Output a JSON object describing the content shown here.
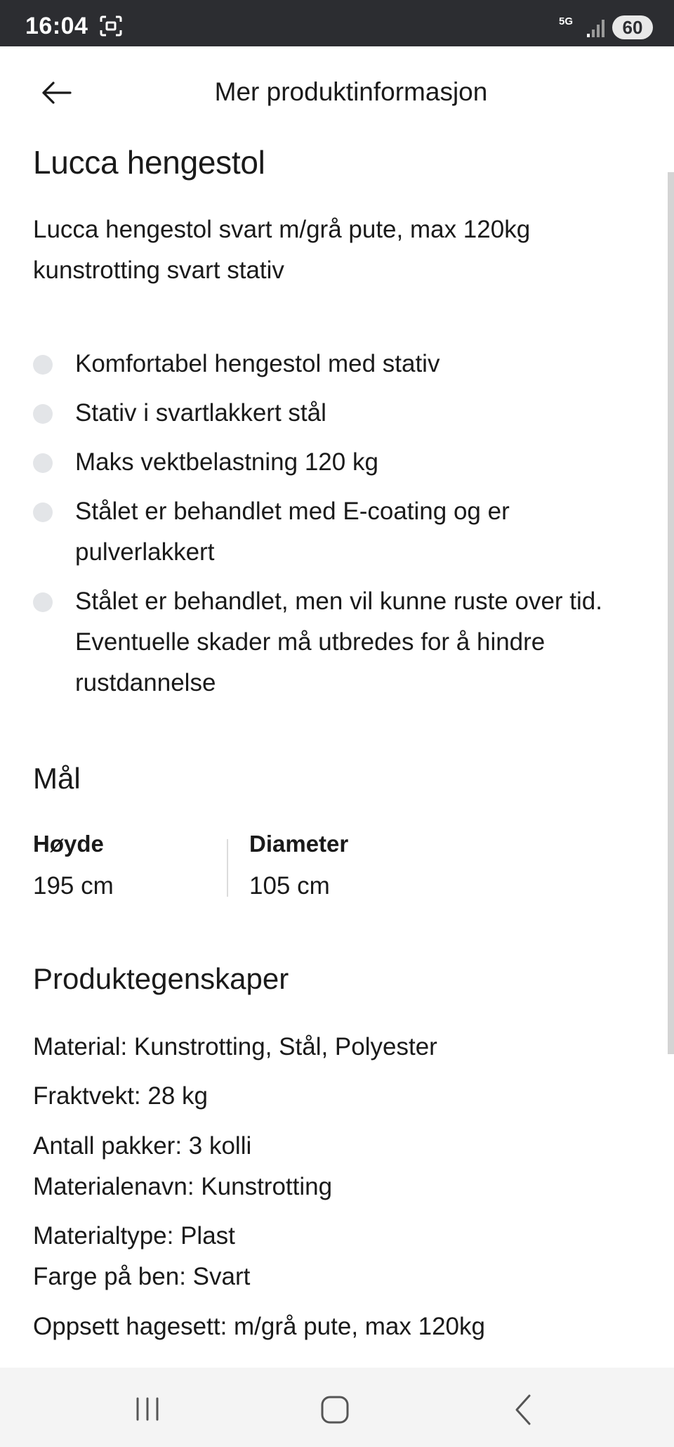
{
  "status_bar": {
    "time": "16:04",
    "network": "5G",
    "battery": "60"
  },
  "app_bar": {
    "title": "Mer produktinformasjon"
  },
  "product": {
    "name": "Lucca hengestol",
    "description": "Lucca hengestol svart m/grå pute, max 120kg kunstrotting svart stativ",
    "features": [
      "Komfortabel hengestol med stativ",
      "Stativ i svartlakkert stål",
      "Maks vektbelastning 120 kg",
      "Stålet er behandlet med E-coating og er pulverlakkert",
      "Stålet er behandlet, men vil kunne ruste over tid. Eventuelle skader må utbredes for å hindre rustdannelse"
    ]
  },
  "dimensions": {
    "heading": "Mål",
    "height_label": "Høyde",
    "height_value": "195 cm",
    "diameter_label": "Diameter",
    "diameter_value": "105 cm"
  },
  "properties": {
    "heading": "Produktegenskaper",
    "items": [
      "Material: Kunstrotting, Stål, Polyester",
      "Fraktvekt: 28 kg",
      "Antall pakker: 3 kolli",
      "Materialenavn: Kunstrotting",
      "Materialtype: Plast",
      "Farge på ben: Svart",
      "Oppsett hagesett: m/grå pute, max 120kg"
    ]
  },
  "nav": {
    "recent_icon": "recent-apps-icon",
    "home_icon": "home-icon",
    "back_icon": "back-icon"
  }
}
